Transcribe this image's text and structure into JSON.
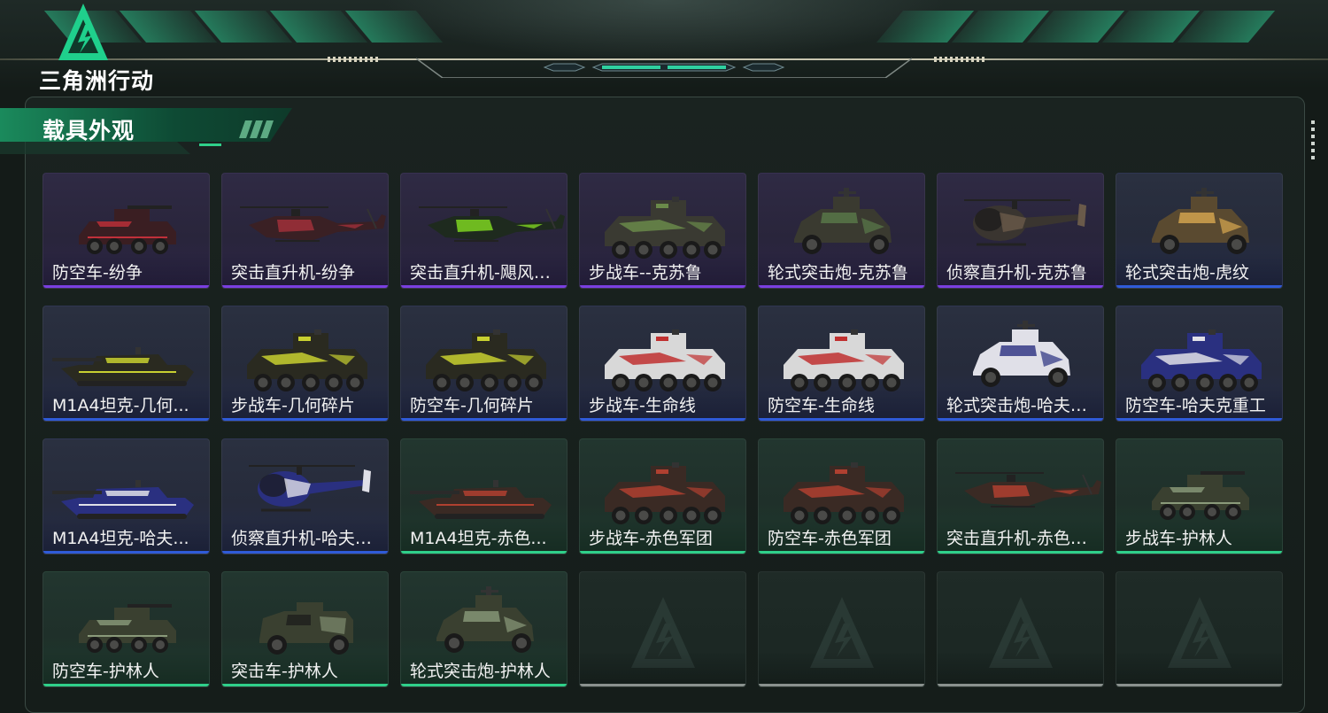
{
  "app": {
    "logo_text": "三角洲行动"
  },
  "section": {
    "title": "载具外观"
  },
  "colors": {
    "purple_rarity": "#7a3fe0",
    "blue_rarity": "#2f5bd8",
    "green_rarity": "#2fd08a",
    "empty_slot": "#8a918e",
    "accent": "#1fd08c"
  },
  "skins": [
    {
      "name": "防空车-纷争",
      "rarity": "purple",
      "vehicle": "apc",
      "palette": [
        "#3a1e22",
        "#c0303a"
      ]
    },
    {
      "name": "突击直升机-纷争",
      "rarity": "purple",
      "vehicle": "heli",
      "palette": [
        "#3a2024",
        "#a0303a"
      ]
    },
    {
      "name": "突击直升机-飓风行...",
      "rarity": "purple",
      "vehicle": "heli",
      "palette": [
        "#1e2a1e",
        "#7ed321"
      ]
    },
    {
      "name": "步战车--克苏鲁",
      "rarity": "purple",
      "vehicle": "ifv",
      "palette": [
        "#3a3a32",
        "#6a8a4a"
      ]
    },
    {
      "name": "轮式突击炮-克苏鲁",
      "rarity": "purple",
      "vehicle": "scout",
      "palette": [
        "#3a3a30",
        "#5a7a4a"
      ]
    },
    {
      "name": "侦察直升机-克苏鲁",
      "rarity": "purple",
      "vehicle": "smallheli",
      "palette": [
        "#3a3530",
        "#6a5a4a"
      ]
    },
    {
      "name": "轮式突击炮-虎纹",
      "rarity": "blue",
      "vehicle": "scout",
      "palette": [
        "#5a4a30",
        "#d8a850"
      ]
    },
    {
      "name": "M1A4坦克-几何...",
      "rarity": "blue",
      "vehicle": "tank",
      "palette": [
        "#2a2a20",
        "#c8d030"
      ]
    },
    {
      "name": "步战车-几何碎片",
      "rarity": "blue",
      "vehicle": "ifv",
      "palette": [
        "#2a2a20",
        "#c8d030"
      ]
    },
    {
      "name": "防空车-几何碎片",
      "rarity": "blue",
      "vehicle": "ifv",
      "palette": [
        "#2a2a20",
        "#c8d030"
      ]
    },
    {
      "name": "步战车-生命线",
      "rarity": "blue",
      "vehicle": "ifv",
      "palette": [
        "#d8d8d8",
        "#c03030"
      ]
    },
    {
      "name": "防空车-生命线",
      "rarity": "blue",
      "vehicle": "ifv",
      "palette": [
        "#d8d8d8",
        "#c03030"
      ]
    },
    {
      "name": "轮式突击炮-哈夫克...",
      "rarity": "blue",
      "vehicle": "scout",
      "palette": [
        "#e0e0e8",
        "#2a3080"
      ]
    },
    {
      "name": "防空车-哈夫克重工",
      "rarity": "blue",
      "vehicle": "ifv",
      "palette": [
        "#2a3080",
        "#e0e0e8"
      ]
    },
    {
      "name": "M1A4坦克-哈夫...",
      "rarity": "blue",
      "vehicle": "tank",
      "palette": [
        "#2a3080",
        "#e0e0e8"
      ]
    },
    {
      "name": "侦察直升机-哈夫克...",
      "rarity": "blue",
      "vehicle": "smallheli",
      "palette": [
        "#2a3080",
        "#e0e0e8"
      ]
    },
    {
      "name": "M1A4坦克-赤色...",
      "rarity": "green",
      "vehicle": "tank",
      "palette": [
        "#3a2a24",
        "#b04030"
      ]
    },
    {
      "name": "步战车-赤色军团",
      "rarity": "green",
      "vehicle": "ifv",
      "palette": [
        "#3a2a24",
        "#b04030"
      ]
    },
    {
      "name": "防空车-赤色军团",
      "rarity": "green",
      "vehicle": "ifv",
      "palette": [
        "#3a2a24",
        "#b04030"
      ]
    },
    {
      "name": "突击直升机-赤色军...",
      "rarity": "green",
      "vehicle": "heli",
      "palette": [
        "#3a2a24",
        "#b04030"
      ]
    },
    {
      "name": "步战车-护林人",
      "rarity": "green",
      "vehicle": "apc",
      "palette": [
        "#3a4030",
        "#8a9a7a"
      ]
    },
    {
      "name": "防空车-护林人",
      "rarity": "green",
      "vehicle": "apc",
      "palette": [
        "#3a4030",
        "#8a9a7a"
      ]
    },
    {
      "name": "突击车-护林人",
      "rarity": "green",
      "vehicle": "mrap",
      "palette": [
        "#3a4030",
        "#8a9a7a"
      ]
    },
    {
      "name": "轮式突击炮-护林人",
      "rarity": "green",
      "vehicle": "scout",
      "palette": [
        "#3a4030",
        "#8a9a7a"
      ]
    },
    {
      "name": "",
      "rarity": "empty",
      "vehicle": "none",
      "palette": []
    },
    {
      "name": "",
      "rarity": "empty",
      "vehicle": "none",
      "palette": []
    },
    {
      "name": "",
      "rarity": "empty",
      "vehicle": "none",
      "palette": []
    },
    {
      "name": "",
      "rarity": "empty",
      "vehicle": "none",
      "palette": []
    }
  ]
}
